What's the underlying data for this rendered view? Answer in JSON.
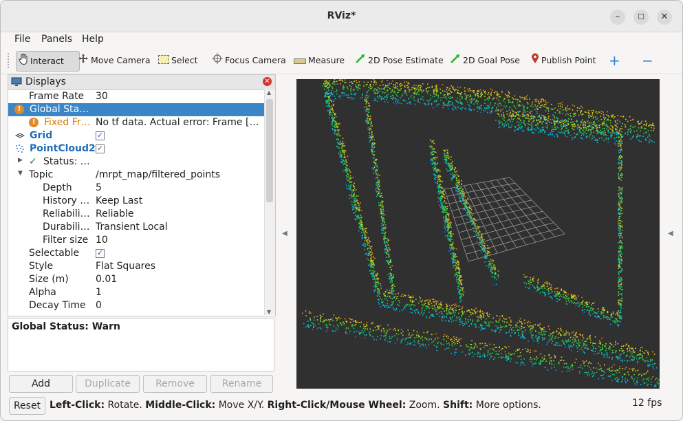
{
  "window": {
    "title": "RViz*"
  },
  "menu": {
    "file": "File",
    "panels": "Panels",
    "help": "Help"
  },
  "toolbar": {
    "interact": "Interact",
    "move_camera": "Move Camera",
    "select": "Select",
    "focus_camera": "Focus Camera",
    "measure": "Measure",
    "pose_estimate": "2D Pose Estimate",
    "goal_pose": "2D Goal Pose",
    "publish_point": "Publish Point"
  },
  "displays": {
    "title": "Displays",
    "rows": [
      {
        "key": "Frame Rate",
        "value": "30"
      },
      {
        "key": "Global Sta…",
        "value": ""
      },
      {
        "key": "Fixed Fr…",
        "value": "No tf data.  Actual error: Frame […"
      },
      {
        "key": "Grid",
        "value": ""
      },
      {
        "key": "PointCloud2",
        "value": ""
      },
      {
        "key": "Status: …",
        "value": ""
      },
      {
        "key": "Topic",
        "value": "/mrpt_map/filtered_points"
      },
      {
        "key": "Depth",
        "value": "5"
      },
      {
        "key": "History …",
        "value": "Keep Last"
      },
      {
        "key": "Reliabili…",
        "value": "Reliable"
      },
      {
        "key": "Durabili…",
        "value": "Transient Local"
      },
      {
        "key": "Filter size",
        "value": "10"
      },
      {
        "key": "Selectable",
        "value": ""
      },
      {
        "key": "Style",
        "value": "Flat Squares"
      },
      {
        "key": "Size (m)",
        "value": "0.01"
      },
      {
        "key": "Alpha",
        "value": "1"
      },
      {
        "key": "Decay Time",
        "value": "0"
      }
    ]
  },
  "status_box": {
    "text": "Global Status: Warn"
  },
  "buttons": {
    "add": "Add",
    "duplicate": "Duplicate",
    "remove": "Remove",
    "rename": "Rename"
  },
  "bottom": {
    "reset": "Reset",
    "hint_parts": [
      "Left-Click:",
      " Rotate. ",
      "Middle-Click:",
      " Move X/Y. ",
      "Right-Click/Mouse Wheel:",
      " Zoom. ",
      "Shift:",
      " More options."
    ],
    "fps": "12 fps"
  }
}
